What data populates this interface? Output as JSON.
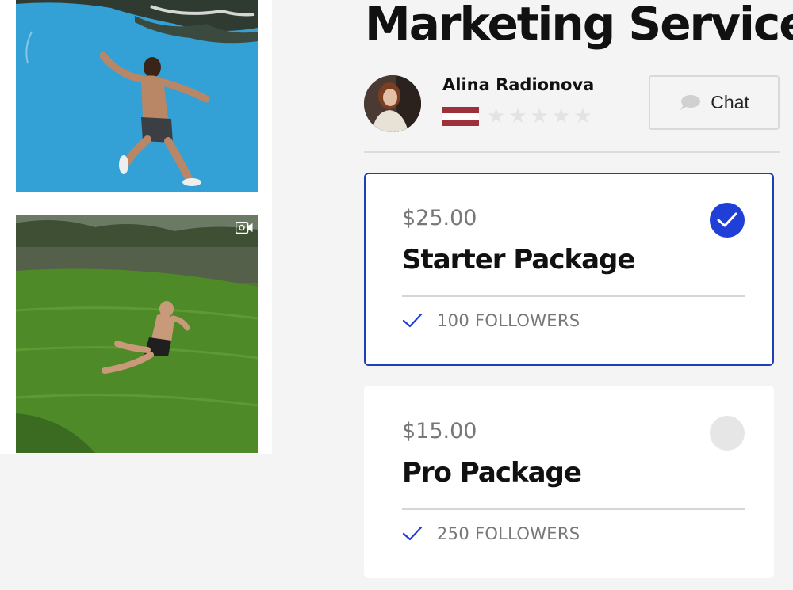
{
  "service": {
    "title": "Marketing Service"
  },
  "seller": {
    "name": "Alina Radionova",
    "rating": 0,
    "rating_max": 5,
    "flag_colors": [
      "#9e3039",
      "#ffffff",
      "#9e3039"
    ]
  },
  "chat": {
    "label": "Chat",
    "icon": "chat-bubble-icon"
  },
  "packages": [
    {
      "price": "$25.00",
      "name": "Starter Package",
      "feature": "100 FOLLOWERS",
      "selected": true
    },
    {
      "price": "$15.00",
      "name": "Pro Package",
      "feature": "250 FOLLOWERS",
      "selected": false
    }
  ],
  "colors": {
    "accent": "#1f3fd6",
    "border_selected": "#1f3fb8"
  }
}
